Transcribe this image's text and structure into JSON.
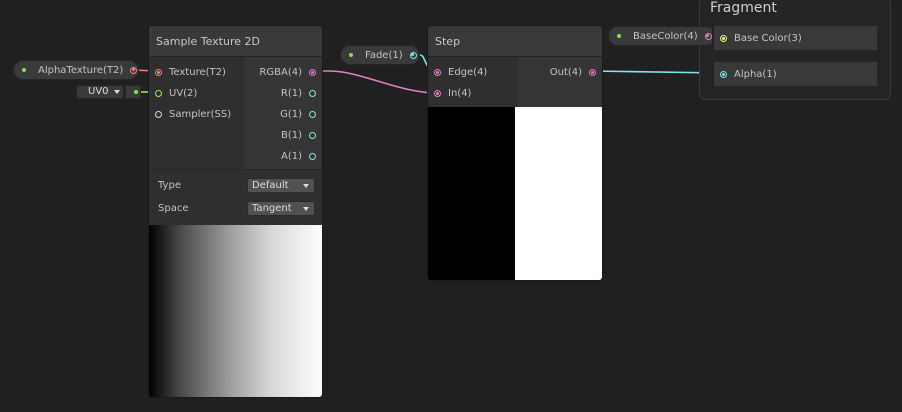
{
  "property_nodes": {
    "alpha_texture": "AlphaTexture(T2)",
    "uv_dropdown": "UV0",
    "fade": "Fade(1)",
    "base_color": "BaseColor(4)"
  },
  "sample_texture": {
    "title": "Sample Texture 2D",
    "inputs": [
      "Texture(T2)",
      "UV(2)",
      "Sampler(SS)"
    ],
    "outputs": [
      "RGBA(4)",
      "R(1)",
      "G(1)",
      "B(1)",
      "A(1)"
    ],
    "type_label": "Type",
    "type_value": "Default",
    "space_label": "Space",
    "space_value": "Tangent"
  },
  "step": {
    "title": "Step",
    "inputs": [
      "Edge(4)",
      "In(4)"
    ],
    "output": "Out(4)"
  },
  "fragment": {
    "title": "Fragment",
    "blocks": [
      "Base Color(3)",
      "Alpha(1)"
    ]
  },
  "colors": {
    "texture_port": "#f08080",
    "vector4_port": "#e57ec7",
    "float_port": "#84e4e7",
    "uv_port": "#9bf05a",
    "color3_port": "#f2f08a"
  }
}
